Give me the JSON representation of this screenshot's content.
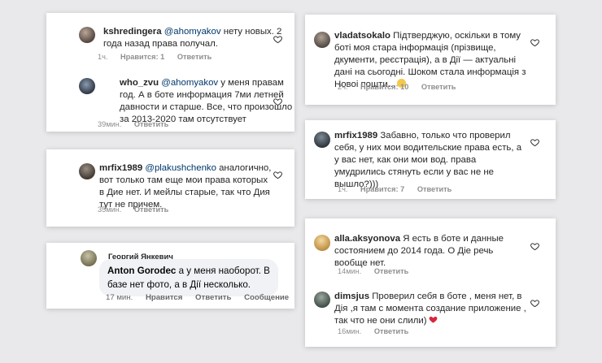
{
  "comments_left": [
    {
      "user": "kshredingera",
      "mention": "@ahomyakov",
      "lines": [
        " нету новых. 2",
        "года назад права получал."
      ],
      "time": "1ч.",
      "likes": "Нравится: 1",
      "reply": "Ответить"
    },
    {
      "user": "who_zvu",
      "mention": "@ahomyakov",
      "lines": [
        " у меня правам",
        "год. А в боте информация 7ми летней",
        "давности и старше. Все, что произошло",
        "за 2013-2020 там отсутствует"
      ],
      "time": "39мин.",
      "reply": "Ответить"
    },
    {
      "user": "mrfix1989",
      "mention": "@plakushchenko",
      "lines": [
        " аналогично,",
        "вот только там еще мои права которых",
        "в Дие нет. И мейлы старые, так что Дия",
        "тут не причем."
      ],
      "time": "35мин.",
      "reply": "Ответить"
    }
  ],
  "fb_comment": {
    "author": "Георгий Янкевич",
    "tag": "Anton Gorodec",
    "lines": [
      " а у меня наоборот. В",
      "базе нет фото, а в Дії несколько."
    ],
    "time": "17 мин.",
    "like": "Нравится",
    "reply": "Ответить",
    "report": "Сообщение"
  },
  "comments_right": [
    {
      "user": "vladatsokalo",
      "lines": [
        " Підтверджую, оскільки в тому",
        "боті моя стара інформація (прізвище,",
        "дкументи, реєстрація), а в Дії — актуальні",
        "дані на сьогодні. Шоком стала информація з",
        "Новоі пошти..."
      ],
      "time": "2ч.",
      "likes": "Нравится: 10",
      "reply": "Ответить"
    },
    {
      "user": "mrfix1989",
      "lines": [
        " Забавно, только что проверил",
        "себя, у них мои водительские права есть, а",
        "у вас нет, как они мои вод. права",
        "умудрились стянуть если у вас не не",
        "вышло?)))"
      ],
      "time": "1ч.",
      "likes": "Нравится: 7",
      "reply": "Ответить"
    },
    {
      "user": "alla.aksyonova",
      "lines": [
        " Я есть в боте и данные",
        "состоянием до 2014 года. О Діе речь",
        "вообще нет."
      ],
      "time": "14мин.",
      "reply": "Ответить"
    },
    {
      "user": "dimsjus",
      "lines": [
        " Проверил себя в боте , меня нет, в",
        "Дія ,я там с момента создание приложение ,",
        "так что не они слили)"
      ],
      "time": "16мин.",
      "reply": "Ответить"
    }
  ],
  "colors": {
    "background": "#e9e9eb",
    "mention": "#00376b",
    "meta": "#8e8e8e",
    "heart": "#e0245e"
  }
}
